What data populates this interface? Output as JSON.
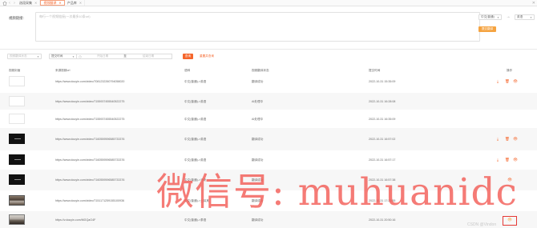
{
  "tabs": [
    {
      "label": "选段采集",
      "active": false
    },
    {
      "label": "视频翻译",
      "active": true
    },
    {
      "label": "产品库",
      "active": false
    }
  ],
  "form": {
    "label": "视频链接:",
    "placeholder": "每行一个视频链接(一次最多10条url)",
    "lang_from": "中文(普通)",
    "lang_to": "英语",
    "arrow": "→",
    "submit_label": "提交翻译"
  },
  "filters": {
    "status_placeholder": "视频翻译状态",
    "time_label": "提交时间",
    "start_placeholder": "开始日期",
    "separator": "至",
    "end_placeholder": "结束日期",
    "search_label": "查询",
    "reset_label": "重置并查询"
  },
  "table": {
    "columns": [
      "视频封面",
      "来源视频url",
      "语种",
      "视频翻译状态",
      "提交时间",
      "操作"
    ],
    "rows": [
      {
        "url": "https://www.douyin.com/video/7081232260794058020",
        "lang": "中文(普通)->英语",
        "status": "翻译成功",
        "time": "2022-10-31 15:35:09",
        "thumb": "white",
        "actions": [
          "download",
          "delete",
          "view"
        ]
      },
      {
        "url": "https://www.douyin.com/video/7155937455540522275",
        "lang": "中文(普通)->英语",
        "status": "AI处理中",
        "time": "2022-10-31 16:28:08",
        "thumb": "white",
        "actions": []
      },
      {
        "url": "https://www.douyin.com/video/7155937455540522275",
        "lang": "中文(普通)->英语",
        "status": "AI处理中",
        "time": "2022-10-31 16:35:09",
        "thumb": "white",
        "actions": []
      },
      {
        "url": "https://www.douyin.com/video/7160559596585733376",
        "lang": "中文(普通)->英语",
        "status": "翻译成功",
        "time": "2022-10-31 16:57:02",
        "thumb": "dark",
        "actions": [
          "download",
          "delete",
          "view"
        ]
      },
      {
        "url": "https://www.douyin.com/video/7160559596585733376",
        "lang": "中文(普通)->英语",
        "status": "翻译成功",
        "time": "2022-10-31 16:57:17",
        "thumb": "dark",
        "actions": [
          "download",
          "delete",
          "view"
        ]
      },
      {
        "url": "https://www.douyin.com/video/7160559596585733376",
        "lang": "中文(普通)->马来",
        "status": "翻译成功",
        "time": "2022-10-31 16:57:38",
        "thumb": "dark",
        "actions": [
          "view"
        ]
      },
      {
        "url": "https://www.douyin.com/video/7151171259155100936",
        "lang": "中文(普通)->土耳其",
        "status": "翻译成功",
        "time": "2022-10-31 17:20:55",
        "thumb": "scene",
        "actions": []
      },
      {
        "url": "https://v.douyin.com/MGQaG4F",
        "lang": "中文(普通)->泰语",
        "status": "翻译成功",
        "time": "2022-10-31 20:50:16",
        "thumb": "road",
        "actions": [
          "view"
        ]
      }
    ]
  },
  "watermark": "微信号: muhuanidc",
  "corner_signature": "CSDN @Vindon"
}
